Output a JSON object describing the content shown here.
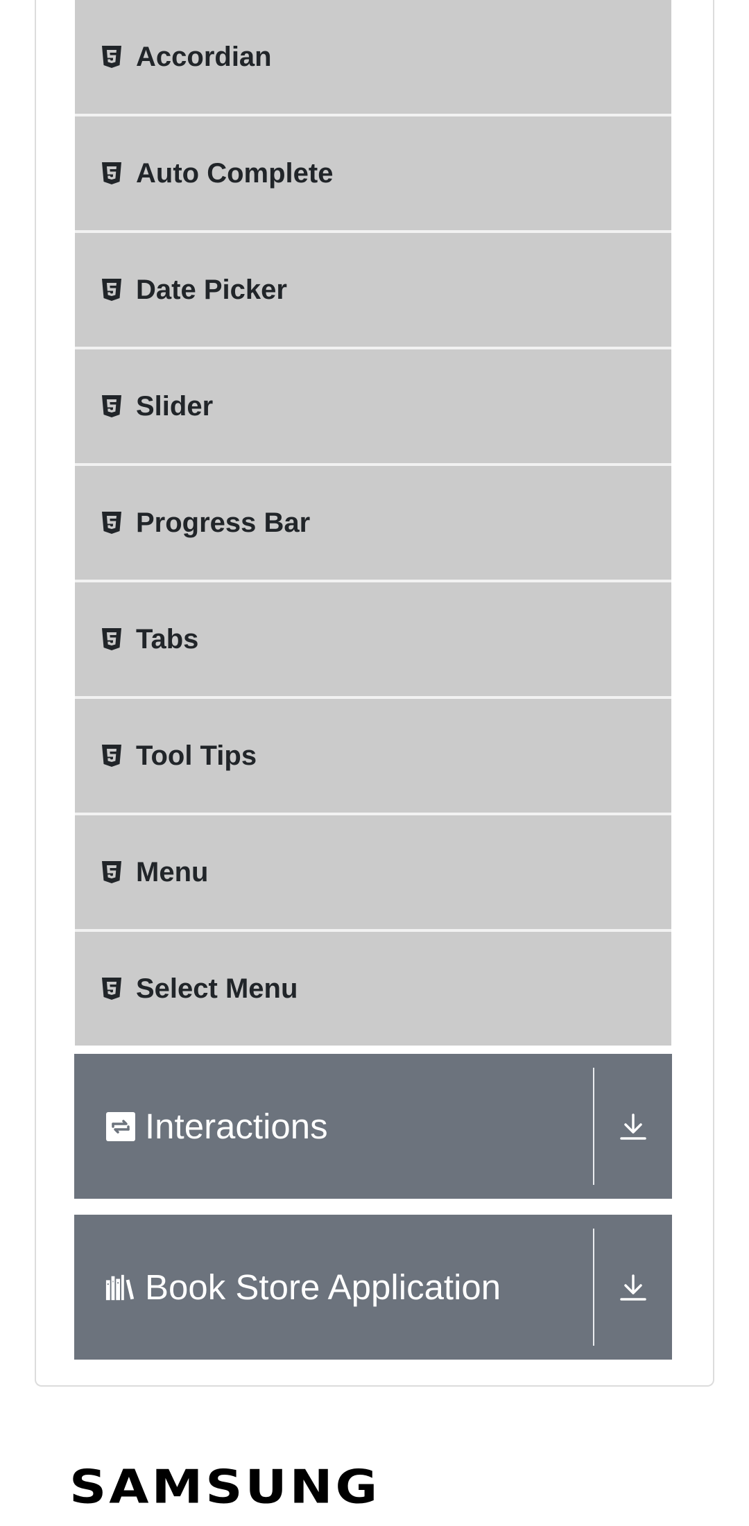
{
  "menu_items": [
    {
      "label": "Accordian",
      "icon": "html5-icon"
    },
    {
      "label": "Auto Complete",
      "icon": "html5-icon"
    },
    {
      "label": "Date Picker",
      "icon": "html5-icon"
    },
    {
      "label": "Slider",
      "icon": "html5-icon"
    },
    {
      "label": "Progress Bar",
      "icon": "html5-icon"
    },
    {
      "label": "Tabs",
      "icon": "html5-icon"
    },
    {
      "label": "Tool Tips",
      "icon": "html5-icon"
    },
    {
      "label": "Menu",
      "icon": "html5-icon"
    },
    {
      "label": "Select Menu",
      "icon": "html5-icon"
    }
  ],
  "groups": {
    "interactions": {
      "label": "Interactions",
      "icon": "interactions-icon",
      "expand_icon": "download-arrow-icon"
    },
    "book_store": {
      "label": "Book Store Application",
      "icon": "books-icon",
      "expand_icon": "download-arrow-icon"
    }
  },
  "footer": {
    "logo_text": "SAMSUNG"
  },
  "colors": {
    "menu_item_bg": "#cbcbcb",
    "menu_text": "#212529",
    "group_header_bg": "#6c737d",
    "group_header_text": "#ffffff"
  }
}
